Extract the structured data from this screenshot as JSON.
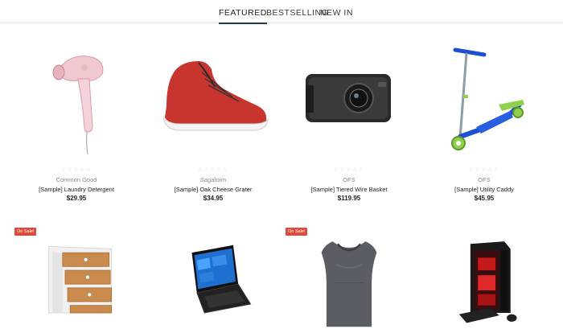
{
  "tabs": [
    {
      "label": "FEATURED",
      "active": true
    },
    {
      "label": "BESTSELLING",
      "active": false
    },
    {
      "label": "NEW IN",
      "active": false
    }
  ],
  "products": [
    {
      "brand": "Common Good",
      "name": "[Sample] Laundry Detergent",
      "price": "$29.95",
      "stars": "☆☆☆☆☆",
      "image": "hair-dryer"
    },
    {
      "brand": "Sagaform",
      "name": "[Sample] Oak Cheese Grater",
      "price": "$34.95",
      "stars": "☆☆☆☆☆",
      "image": "red-sneaker"
    },
    {
      "brand": "OFS",
      "name": "[Sample] Tiered Wire Basket",
      "price": "$119.95",
      "stars": "☆☆☆☆☆",
      "image": "dash-camera"
    },
    {
      "brand": "OFS",
      "name": "[Sample] Utility Caddy",
      "price": "$45.95",
      "stars": "☆☆☆☆☆",
      "image": "kick-scooter"
    },
    {
      "image": "chest-of-drawers",
      "on_sale": true
    },
    {
      "image": "laptop",
      "on_sale": false
    },
    {
      "image": "compression-shirt",
      "on_sale": true
    },
    {
      "image": "gaming-pc",
      "on_sale": false
    }
  ],
  "sale_badge_label": "On Sale!",
  "colors": {
    "accent": "#1f3a52",
    "sale": "#e04a3a"
  }
}
